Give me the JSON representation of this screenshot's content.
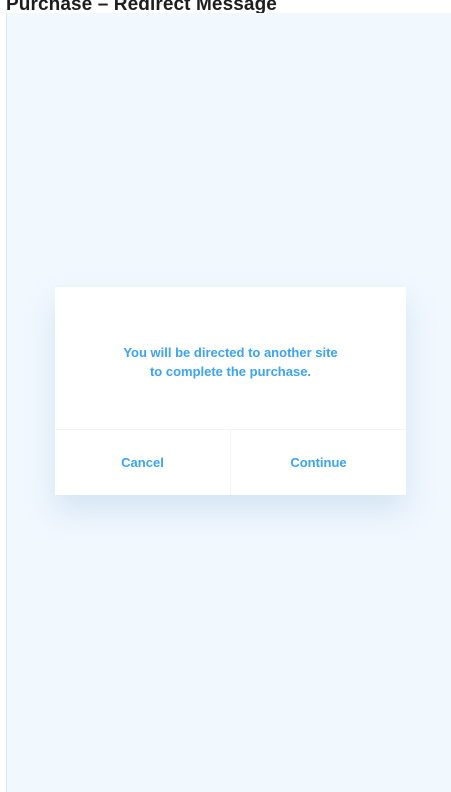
{
  "frame": {
    "title": "Purchase – Redirect Message"
  },
  "dialog": {
    "message_line1": "You will be directed to another site",
    "message_line2": "to complete the purchase.",
    "cancel_label": "Cancel",
    "continue_label": "Continue"
  },
  "colors": {
    "accent": "#3aa4f1",
    "screen_background": "#f1f8fe",
    "dialog_background": "#ffffff"
  }
}
